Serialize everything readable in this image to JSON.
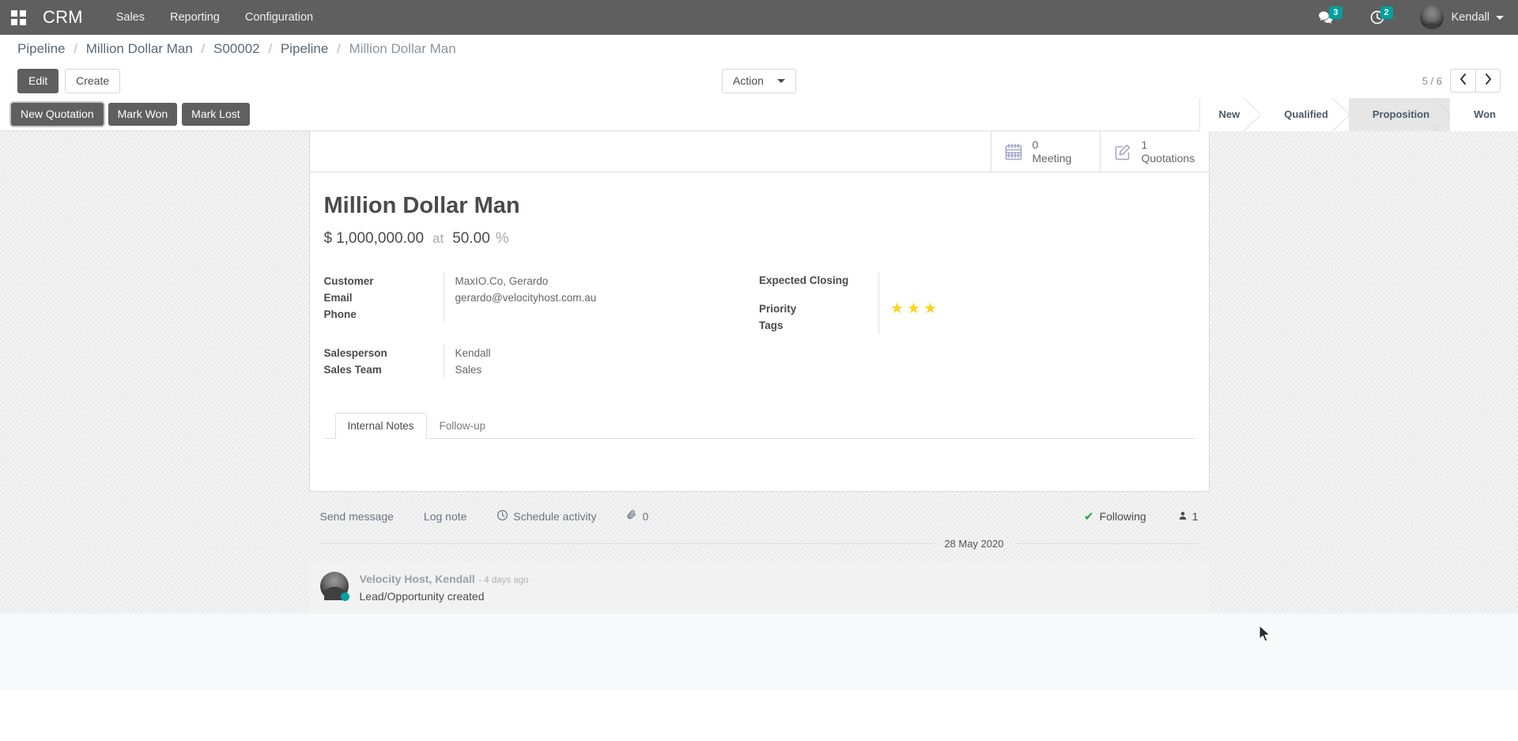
{
  "navbar": {
    "apps_icon": "apps-grid-icon",
    "brand": "CRM",
    "menu": [
      {
        "label": "Sales"
      },
      {
        "label": "Reporting"
      },
      {
        "label": "Configuration"
      }
    ],
    "messages_icon": "chat-bubble-icon",
    "messages_count": "3",
    "activities_icon": "clock-icon",
    "activities_count": "2",
    "user_name": "Kendall",
    "avatar_icon": "user-avatar"
  },
  "breadcrumb": {
    "items": [
      "Pipeline",
      "Million Dollar Man",
      "S00002",
      "Pipeline",
      "Million Dollar Man"
    ],
    "separator": "/"
  },
  "control_panel": {
    "edit_label": "Edit",
    "create_label": "Create",
    "action_label": "Action",
    "pager_value": "5 / 6",
    "prev_icon": "chevron-left-icon",
    "next_icon": "chevron-right-icon"
  },
  "statusbar": {
    "buttons": [
      {
        "label": "New Quotation",
        "focused": true
      },
      {
        "label": "Mark Won",
        "focused": false
      },
      {
        "label": "Mark Lost",
        "focused": false
      }
    ],
    "stages": [
      {
        "label": "New",
        "current": false
      },
      {
        "label": "Qualified",
        "current": false
      },
      {
        "label": "Proposition",
        "current": true
      },
      {
        "label": "Won",
        "current": false
      }
    ]
  },
  "stat_buttons": [
    {
      "icon": "calendar-icon",
      "value": "0",
      "label": "Meeting"
    },
    {
      "icon": "edit-document-icon",
      "value": "1",
      "label": "Quotations"
    }
  ],
  "record": {
    "title": "Million Dollar Man",
    "currency_symbol": "$",
    "expected_revenue": "1,000,000.00",
    "at_word": "at",
    "probability": "50.00",
    "percent_symbol": "%",
    "left_fields": [
      {
        "label": "Customer",
        "value": "MaxIO.Co, Gerardo"
      },
      {
        "label": "Email",
        "value": "gerardo@velocityhost.com.au"
      },
      {
        "label": "Phone",
        "value": ""
      }
    ],
    "left_fields_2": [
      {
        "label": "Salesperson",
        "value": "Kendall"
      },
      {
        "label": "Sales Team",
        "value": "Sales"
      }
    ],
    "right_fields": [
      {
        "label": "Expected Closing",
        "value": ""
      },
      {
        "label": "Priority",
        "value": ""
      },
      {
        "label": "Tags",
        "value": ""
      }
    ],
    "priority_stars_filled": 3,
    "star_glyph": "★",
    "star_color": "#ffd21e"
  },
  "notebook": {
    "tabs": [
      {
        "label": "Internal Notes",
        "active": true
      },
      {
        "label": "Follow-up",
        "active": false
      }
    ]
  },
  "chatter": {
    "send_message_label": "Send message",
    "log_note_label": "Log note",
    "schedule_activity_label": "Schedule activity",
    "schedule_activity_icon": "clock-icon",
    "attachment_icon": "paperclip-icon",
    "attachment_count": "0",
    "following_label": "Following",
    "following_icon": "check-icon",
    "followers_icon": "user-icon",
    "followers_count": "1",
    "date_separator": "28 May 2020",
    "messages": [
      {
        "author": "Velocity Host, Kendall",
        "time": "- 4 days ago",
        "text": "Lead/Opportunity created",
        "avatar_icon": "user-avatar",
        "presence": "online"
      }
    ]
  },
  "colors": {
    "navbar_bg": "#5f5f5f",
    "accent_teal": "#00a09d",
    "star_gold": "#ffd21e",
    "following_green": "#28a745",
    "stat_icon": "#a4a4c8"
  },
  "cursor": {
    "icon": "mouse-pointer"
  }
}
